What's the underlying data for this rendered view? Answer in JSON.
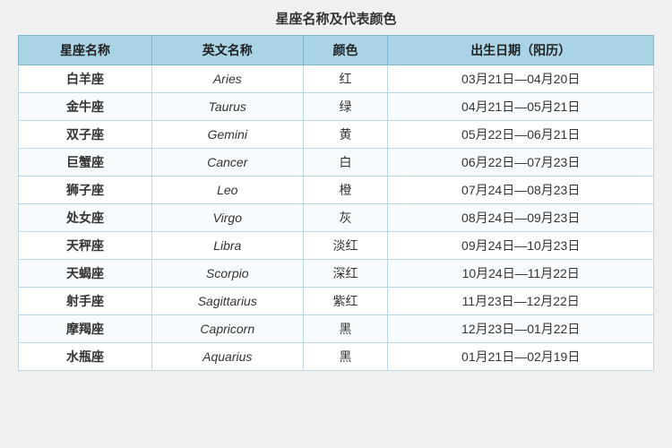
{
  "title": "星座名称及代表颜色",
  "headers": {
    "col1": "星座名称",
    "col2": "英文名称",
    "col3": "颜色",
    "col4": "出生日期（阳历）"
  },
  "rows": [
    {
      "chinese": "白羊座",
      "english": "Aries",
      "color": "红",
      "dates": "03月21日—04月20日"
    },
    {
      "chinese": "金牛座",
      "english": "Taurus",
      "color": "绿",
      "dates": "04月21日—05月21日"
    },
    {
      "chinese": "双子座",
      "english": "Gemini",
      "color": "黄",
      "dates": "05月22日—06月21日"
    },
    {
      "chinese": "巨蟹座",
      "english": "Cancer",
      "color": "白",
      "dates": "06月22日—07月23日"
    },
    {
      "chinese": "狮子座",
      "english": "Leo",
      "color": "橙",
      "dates": "07月24日—08月23日"
    },
    {
      "chinese": "处女座",
      "english": "Virgo",
      "color": "灰",
      "dates": "08月24日—09月23日"
    },
    {
      "chinese": "天秤座",
      "english": "Libra",
      "color": "淡红",
      "dates": "09月24日—10月23日"
    },
    {
      "chinese": "天蝎座",
      "english": "Scorpio",
      "color": "深红",
      "dates": "10月24日—11月22日"
    },
    {
      "chinese": "射手座",
      "english": "Sagittarius",
      "color": "紫红",
      "dates": "11月23日—12月22日"
    },
    {
      "chinese": "摩羯座",
      "english": "Capricorn",
      "color": "黑",
      "dates": "12月23日—01月22日"
    },
    {
      "chinese": "水瓶座",
      "english": "Aquarius",
      "color": "黑",
      "dates": "01月21日—02月19日"
    }
  ]
}
